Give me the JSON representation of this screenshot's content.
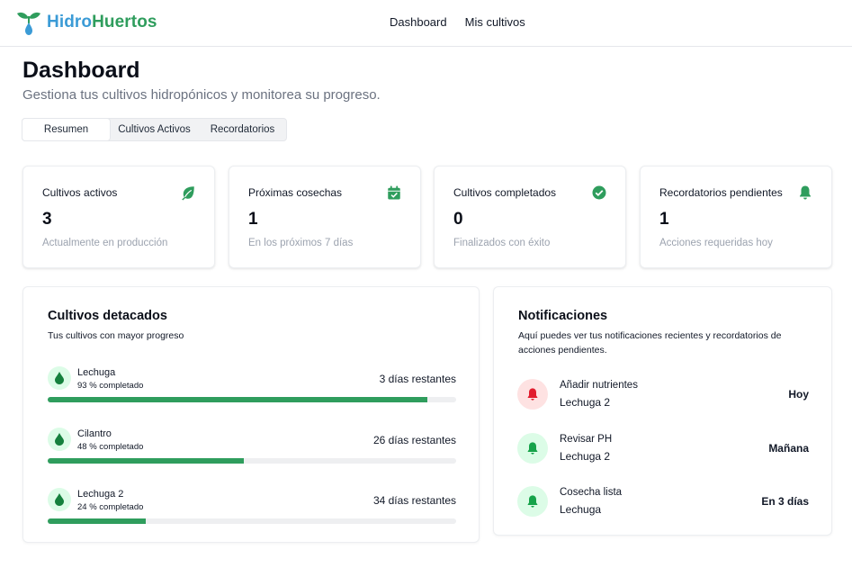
{
  "brand": {
    "part1": "Hidro",
    "part2": "Huertos"
  },
  "nav": {
    "dashboard": "Dashboard",
    "my_crops": "Mis cultivos"
  },
  "page": {
    "title": "Dashboard",
    "subtitle": "Gestiona tus cultivos hidropónicos y monitorea su progreso."
  },
  "tabs": [
    {
      "label": "Resumen",
      "active": true
    },
    {
      "label": "Cultivos Activos",
      "active": false
    },
    {
      "label": "Recordatorios",
      "active": false
    }
  ],
  "stats": [
    {
      "label": "Cultivos activos",
      "value": "3",
      "sub": "Actualmente en producción",
      "icon": "leaf-icon"
    },
    {
      "label": "Próximas cosechas",
      "value": "1",
      "sub": "En los próximos 7 días",
      "icon": "calendar-check-icon"
    },
    {
      "label": "Cultivos completados",
      "value": "0",
      "sub": "Finalizados con éxito",
      "icon": "check-circle-icon"
    },
    {
      "label": "Recordatorios pendientes",
      "value": "1",
      "sub": "Acciones requeridas hoy",
      "icon": "bell-icon"
    }
  ],
  "featured": {
    "title": "Cultivos detacados",
    "subtitle": "Tus cultivos con mayor progreso",
    "items": [
      {
        "name": "Lechuga",
        "progress_text": "93 % completado",
        "progress": 0.93,
        "days": "3 días restantes",
        "icon": "droplet-icon"
      },
      {
        "name": "Cilantro",
        "progress_text": "48 % completado",
        "progress": 0.48,
        "days": "26 días restantes",
        "icon": "droplet-icon"
      },
      {
        "name": "Lechuga 2",
        "progress_text": "24 % completado",
        "progress": 0.24,
        "days": "34 días restantes",
        "icon": "droplet-icon"
      }
    ]
  },
  "notifications": {
    "title": "Notificaciones",
    "subtitle": "Aquí puedes ver tus notificaciones recientes y recordatorios de acciones pendientes.",
    "items": [
      {
        "title": "Añadir nutrientes",
        "crop": "Lechuga 2",
        "time": "Hoy",
        "color": "red",
        "icon": "bell-icon"
      },
      {
        "title": "Revisar PH",
        "crop": "Lechuga 2",
        "time": "Mañana",
        "color": "green",
        "icon": "bell-icon"
      },
      {
        "title": "Cosecha lista",
        "crop": "Lechuga",
        "time": "En 3 días",
        "color": "green",
        "icon": "bell-icon"
      }
    ]
  },
  "colors": {
    "brand_blue": "#3b9bd6",
    "brand_green": "#2f9d5d",
    "progress": "#2f9d5d",
    "alert_red": "#e11d2e",
    "icon_green": "#16a34a"
  }
}
